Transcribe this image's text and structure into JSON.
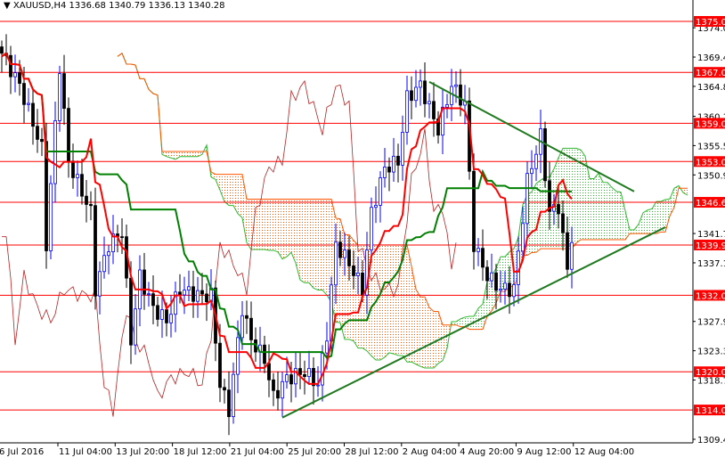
{
  "header": {
    "symbol": "XAUUSD,H4",
    "ohlc": "1336.68 1340.79 1336.13 1340.28"
  },
  "chart_data": {
    "type": "candlestick",
    "title": "XAUUSD,H4",
    "ylim": [
      1309.4,
      1375.0
    ],
    "y_ticks": [
      "1374.00",
      "1369.40",
      "1364.80",
      "1360.10",
      "1355.50",
      "1350.90",
      "1341.70",
      "1337.10",
      "1327.90",
      "1323.30",
      "1318.70",
      "1309.40"
    ],
    "levels": [
      "1375.00",
      "1367.00",
      "1359.00",
      "1353.00",
      "1346.60",
      "1339.90",
      "1332.00",
      "1320.00",
      "1314.00"
    ],
    "x_labels": [
      "6 Jul 2016",
      "11 Jul 04:00",
      "13 Jul 20:00",
      "18 Jul 12:00",
      "21 Jul 04:00",
      "25 Jul 20:00",
      "28 Jul 12:00",
      "2 Aug 04:00",
      "4 Aug 20:00",
      "9 Aug 12:00",
      "12 Aug 04:00"
    ],
    "bars_total": 156,
    "close_path": [
      [
        0,
        1370
      ],
      [
        4,
        1365
      ],
      [
        9,
        1355
      ],
      [
        10,
        1340
      ],
      [
        13,
        1368
      ],
      [
        15,
        1353
      ],
      [
        20,
        1345
      ],
      [
        21,
        1333
      ],
      [
        24,
        1340
      ],
      [
        27,
        1342
      ],
      [
        29,
        1325
      ],
      [
        31,
        1335
      ],
      [
        34,
        1330
      ],
      [
        37,
        1328
      ],
      [
        40,
        1333
      ],
      [
        44,
        1332
      ],
      [
        47,
        1332
      ],
      [
        49,
        1318
      ],
      [
        51,
        1314
      ],
      [
        54,
        1330
      ],
      [
        56,
        1325
      ],
      [
        59,
        1322
      ],
      [
        61,
        1316
      ],
      [
        64,
        1319
      ],
      [
        68,
        1320
      ],
      [
        71,
        1318
      ],
      [
        73,
        1326
      ],
      [
        75,
        1340
      ],
      [
        78,
        1337
      ],
      [
        81,
        1333
      ],
      [
        83,
        1345
      ],
      [
        86,
        1352
      ],
      [
        89,
        1353
      ],
      [
        91,
        1363
      ],
      [
        94,
        1365
      ],
      [
        98,
        1358
      ],
      [
        101,
        1365
      ],
      [
        104,
        1362
      ],
      [
        106,
        1340
      ],
      [
        109,
        1335
      ],
      [
        112,
        1333
      ],
      [
        115,
        1333
      ],
      [
        118,
        1350
      ],
      [
        121,
        1357
      ],
      [
        123,
        1345
      ],
      [
        125,
        1346
      ],
      [
        127,
        1336
      ],
      [
        128,
        1340.28
      ]
    ],
    "trendlines": [
      {
        "name": "resistance",
        "from": [
          96,
          1365.5
        ],
        "to": [
          142,
          1348.3
        ]
      },
      {
        "name": "support",
        "from": [
          63,
          1312.8
        ],
        "to": [
          149,
          1342.7
        ]
      }
    ],
    "colors": {
      "bull": "#0000ff",
      "bear": "#000000",
      "tenkan": "#ff0000",
      "kijun": "#008000",
      "level": "#ff0000",
      "trend": "#1f7a1f",
      "cloud_up": "#2eb82e",
      "cloud_down": "#ff5500"
    }
  }
}
